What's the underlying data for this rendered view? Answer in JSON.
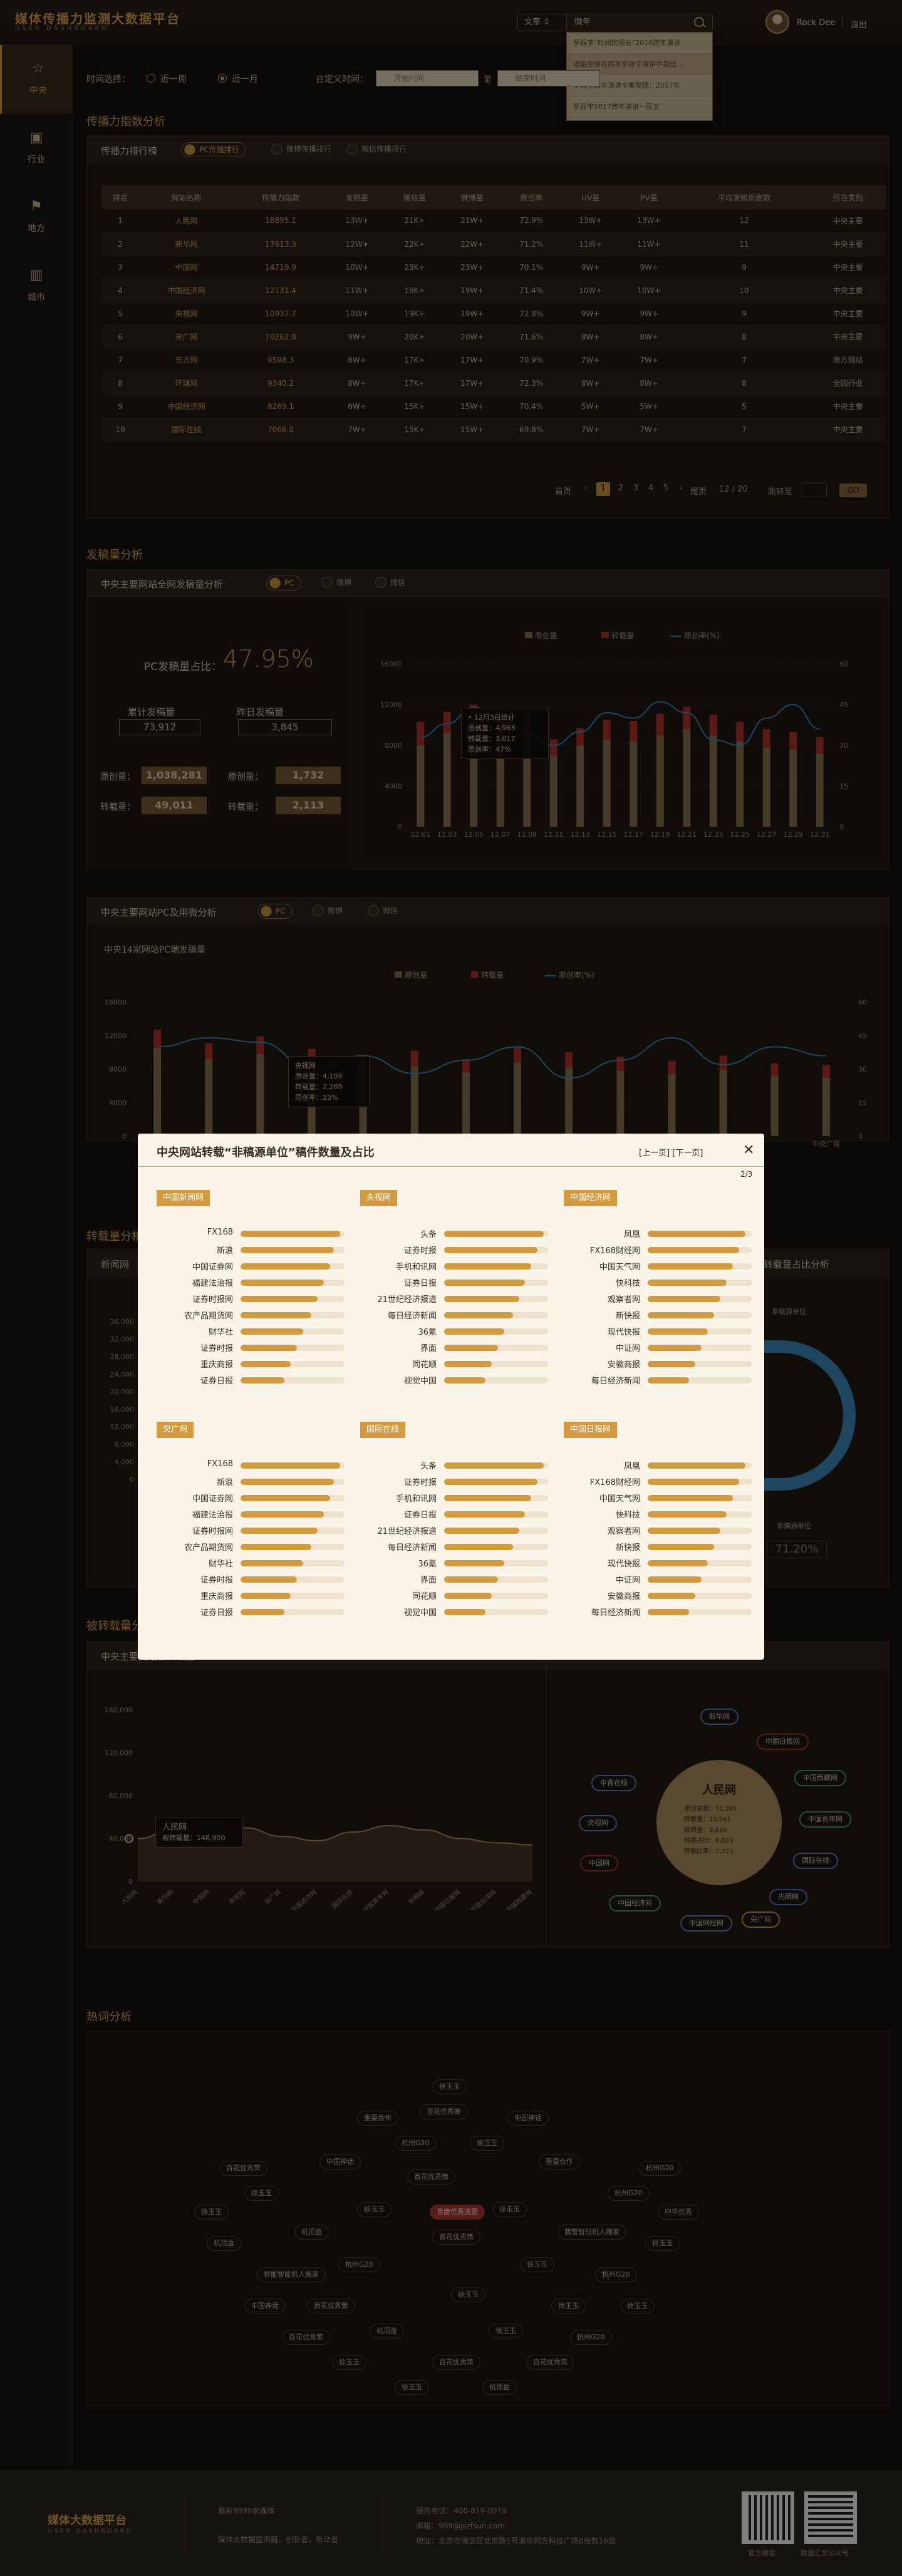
{
  "brand": {
    "title": "媒体传播力监测大数据平台",
    "subtitle": "USER DASHBOARD"
  },
  "search": {
    "type": "文章 ⇕",
    "query": "微年",
    "suggestions": [
      "罗振宇“时间的朋友”2016跨年演讲",
      "逻辑思维在跨年罗振宇演讲中提出…",
      "罗振宇跨年演讲全集整理：2017年",
      "罗振宇2017跨年演讲一原文"
    ]
  },
  "user": {
    "name": "Rock Dee",
    "logout": "退出"
  },
  "sidebar": [
    {
      "label": "中央",
      "icon": "☆"
    },
    {
      "label": "行业",
      "icon": "▣"
    },
    {
      "label": "地方",
      "icon": "⚑"
    },
    {
      "label": "城市",
      "icon": "▥"
    }
  ],
  "filter": {
    "label": "时间选择：",
    "opt1": "近一周",
    "opt2": "近一月",
    "custom": "自定义时间：",
    "start": "开始时间",
    "to": "至",
    "end": "结束时间"
  },
  "sec1": {
    "title": "传播力指数分析",
    "panel": "传播力排行榜",
    "tabs": [
      "PC传播排行",
      "微博传播排行",
      "微信传播排行"
    ]
  },
  "rank_table": {
    "headers": [
      "排名",
      "网站名称",
      "传播力指数",
      "发稿量",
      "微信量",
      "微博量",
      "原创率",
      "UV量",
      "PV量",
      "平均发稿页面数",
      "所在类别"
    ],
    "rows": [
      [
        "1",
        "人民网",
        "18895.1",
        "13W+",
        "21K+",
        "21W+",
        "72.9%",
        "13W+",
        "13W+",
        "12",
        "中央主要"
      ],
      [
        "2",
        "新华网",
        "17613.3",
        "12W+",
        "22K+",
        "22W+",
        "71.2%",
        "11W+",
        "11W+",
        "11",
        "中央主要"
      ],
      [
        "3",
        "中国网",
        "14719.9",
        "10W+",
        "23K+",
        "23W+",
        "70.1%",
        "9W+",
        "9W+",
        "9",
        "中央主要"
      ],
      [
        "4",
        "中国经济网",
        "12131.4",
        "11W+",
        "19K+",
        "19W+",
        "71.4%",
        "10W+",
        "10W+",
        "10",
        "中央主要"
      ],
      [
        "5",
        "央视网",
        "10937.7",
        "10W+",
        "19K+",
        "19W+",
        "72.8%",
        "9W+",
        "9W+",
        "9",
        "中央主要"
      ],
      [
        "6",
        "央广网",
        "10262.8",
        "9W+",
        "20K+",
        "20W+",
        "71.6%",
        "8W+",
        "8W+",
        "8",
        "中央主要"
      ],
      [
        "7",
        "东方网",
        "9598.3",
        "8W+",
        "17K+",
        "17W+",
        "70.9%",
        "7W+",
        "7W+",
        "7",
        "地方网站"
      ],
      [
        "8",
        "环球网",
        "9340.2",
        "8W+",
        "17K+",
        "17W+",
        "72.3%",
        "8W+",
        "8W+",
        "8",
        "全国行业"
      ],
      [
        "9",
        "中国经济网",
        "8269.1",
        "6W+",
        "15K+",
        "15W+",
        "70.4%",
        "5W+",
        "5W+",
        "5",
        "中央主要"
      ],
      [
        "10",
        "国际在线",
        "7066.0",
        "7W+",
        "15K+",
        "15W+",
        "69.8%",
        "7W+",
        "7W+",
        "7",
        "中央主要"
      ]
    ]
  },
  "pager": {
    "prev": "首页",
    "pages": [
      "1",
      "2",
      "3",
      "4",
      "5"
    ],
    "next": "尾页",
    "total": "12 / 20",
    "jump": "跳转至",
    "go": "GO"
  },
  "sec2": {
    "title": "发稿量分析",
    "panel": "中央主要网站全网发稿量分析",
    "tabs": [
      "PC",
      "微博",
      "微信"
    ]
  },
  "pc_share": {
    "label": "PC发稿量占比：",
    "value": "47.95%",
    "total_label": "累计发稿量",
    "total": "73,912",
    "yesterday_label": "昨日发稿量",
    "yesterday": "3,845",
    "orig_label": "原创量：",
    "orig": "1,038,281",
    "orig2_label": "原创量：",
    "orig2": "1,732",
    "repost_label": "转载量：",
    "repost": "49,011",
    "repost2_label": "转载量：",
    "repost2": "2,113"
  },
  "chart1_tip": {
    "title": "• 12月3日统计",
    "l1": "原创量：4,963",
    "l2": "转载量：3,017",
    "l3": "原创率：47%"
  },
  "chart_data": [
    {
      "type": "bar",
      "title": "",
      "categories": [
        "12.01",
        "12.03",
        "12.05",
        "12.07",
        "12.09",
        "12.11",
        "12.13",
        "12.15",
        "12.17",
        "12.19",
        "12.21",
        "12.23",
        "12.25",
        "12.27",
        "12.29",
        "12.31"
      ],
      "series": [
        {
          "name": "原创量",
          "values": [
            8000,
            9200,
            9800,
            9000,
            9400,
            7000,
            8000,
            8600,
            8400,
            9000,
            9600,
            9000,
            8400,
            7800,
            7600,
            7200
          ]
        },
        {
          "name": "转载量",
          "values": [
            2300,
            2100,
            2200,
            1800,
            2000,
            1600,
            1700,
            1900,
            2000,
            2100,
            2200,
            2000,
            1900,
            1800,
            1700,
            1600
          ]
        },
        {
          "name": "原创率(%)",
          "values": [
            33,
            38,
            44,
            40,
            34,
            30,
            35,
            42,
            40,
            46,
            42,
            32,
            30,
            40,
            45,
            36
          ]
        }
      ],
      "ylim": [
        0,
        16000
      ],
      "y2lim": [
        0,
        60
      ],
      "yticks": [
        "0",
        "4000",
        "8000",
        "12000",
        "16000"
      ],
      "y2ticks": [
        "0",
        "15",
        "30",
        "45",
        "60"
      ]
    },
    {
      "type": "bar",
      "title": "中央14家网站PC端发稿量",
      "categories": [
        "",
        "",
        "",
        "",
        "",
        "",
        "",
        "",
        "",
        "",
        "",
        "",
        "",
        "中央广播"
      ],
      "series": [
        {
          "name": "原创量",
          "values": [
            10500,
            9200,
            9800,
            8600,
            8000,
            8400,
            7600,
            8800,
            8200,
            7800,
            7400,
            7900,
            7200,
            7000
          ]
        },
        {
          "name": "转载量",
          "values": [
            2200,
            1900,
            2100,
            1800,
            1700,
            1800,
            1600,
            1900,
            1800,
            1700,
            1600,
            1700,
            1500,
            1500
          ]
        },
        {
          "name": "原创率(%)",
          "values": [
            40,
            44,
            42,
            30,
            36,
            28,
            34,
            40,
            26,
            34,
            44,
            32,
            40,
            36
          ]
        }
      ],
      "ylim": [
        0,
        16000
      ],
      "y2lim": [
        0,
        60
      ],
      "yticks": [
        "0",
        "4000",
        "8000",
        "12000",
        "16000"
      ],
      "y2ticks": [
        "0",
        "15",
        "30",
        "45",
        "60"
      ]
    },
    {
      "type": "area",
      "title": "",
      "x": [
        "人民网",
        "新华网",
        "中国网",
        "央视网",
        "央广网",
        "中国经济网",
        "国际在线",
        "中国青年网",
        "光明网",
        "中国日报网",
        "中国台湾网",
        "中国西藏网"
      ],
      "values": [
        40000,
        48000,
        55000,
        50000,
        42000,
        38000,
        46000,
        52000,
        48000,
        40000,
        36000,
        34000
      ],
      "ylim": [
        0,
        160000
      ],
      "yticks": [
        "0",
        "40,000",
        "80,000",
        "120,000",
        "160,000"
      ]
    }
  ],
  "legend": {
    "orig": "原创量",
    "repost": "转载量",
    "rate": "原创率(%)"
  },
  "sec3": {
    "panel": "中央主要网站PC及用微分析",
    "tabs": [
      "PC",
      "微博",
      "微信"
    ],
    "subtitle": "中央14家网站PC端发稿量"
  },
  "chart2_tip": {
    "title": "央视网",
    "l1": "原创量：4,109",
    "l2": "转载量：2,269",
    "l3": "原创率：23%"
  },
  "sec4": {
    "title": "转载量分析",
    "panel_left": "新闻网",
    "panel_right": "转载量占比分析",
    "donut_label": "非稿源单位",
    "donut_value": "71.20%",
    "legend1": "非稿源单位",
    "yticks": [
      "0",
      "4,000",
      "8,000",
      "12,000",
      "16,000",
      "20,000",
      "24,000",
      "28,000",
      "32,000",
      "36,000"
    ]
  },
  "sec5": {
    "title": "被转载量分析",
    "panel": "中央主要网站被转载量",
    "tip_title": "人民网",
    "tip_val": "被转载量：148,900"
  },
  "network": {
    "center": "人民网",
    "stats": [
      "原创总数：11,281",
      "转载量：10,961",
      "被转量：9,886",
      "转载占比：8,621",
      "转载比率：7,721"
    ],
    "nodes": [
      "新华网",
      "中国日报网",
      "中国西藏网",
      "中国青年网",
      "国际在线",
      "光明网",
      "央广网",
      "中国网经网",
      "中国经济网",
      "中国网",
      "央视网",
      "中青在线"
    ]
  },
  "modal": {
    "title": "中央网站转载“非稿源单位”稿件数量及占比",
    "nav": "[上一页] [下一页]",
    "close": "✕",
    "page": "2/3",
    "groups": [
      {
        "name": "中国新闻网",
        "items": [
          "FX168",
          "新浪",
          "中国证券网",
          "福建法治报",
          "证券时报网",
          "农产品期货网",
          "财华社",
          "证券时报",
          "重庆商报",
          "证券日报"
        ],
        "vals": [
          96,
          90,
          86,
          80,
          74,
          68,
          60,
          54,
          48,
          42
        ]
      },
      {
        "name": "央视网",
        "items": [
          "头条",
          "证券时报",
          "手机和讯网",
          "证券日报",
          "21世纪经济报道",
          "每日经济新闻",
          "36氪",
          "界面",
          "同花顺",
          "视觉中国"
        ],
        "vals": [
          96,
          90,
          84,
          78,
          72,
          66,
          58,
          52,
          46,
          40
        ]
      },
      {
        "name": "中国经济网",
        "items": [
          "凤凰",
          "FX168财经网",
          "中国天气网",
          "快科技",
          "观察者网",
          "新快报",
          "现代快报",
          "中证网",
          "安徽商报",
          "每日经济新闻"
        ],
        "vals": [
          94,
          88,
          82,
          76,
          70,
          64,
          58,
          52,
          46,
          40
        ]
      },
      {
        "name": "央广网",
        "items": [
          "FX168",
          "新浪",
          "中国证券网",
          "福建法治报",
          "证券时报网",
          "农产品期货网",
          "财华社",
          "证券时报",
          "重庆商报",
          "证券日报"
        ],
        "vals": [
          96,
          90,
          86,
          80,
          74,
          68,
          60,
          54,
          48,
          42
        ]
      },
      {
        "name": "国际在线",
        "items": [
          "头条",
          "证券时报",
          "手机和讯网",
          "证券日报",
          "21世纪经济报道",
          "每日经济新闻",
          "36氪",
          "界面",
          "同花顺",
          "视觉中国"
        ],
        "vals": [
          96,
          90,
          84,
          78,
          72,
          66,
          58,
          52,
          46,
          40
        ]
      },
      {
        "name": "中国日报网",
        "items": [
          "凤凰",
          "FX168财经网",
          "中国天气网",
          "快科技",
          "观察者网",
          "新快报",
          "现代快报",
          "中证网",
          "安徽商报",
          "每日经济新闻"
        ],
        "vals": [
          94,
          88,
          82,
          76,
          70,
          64,
          58,
          52,
          46,
          40
        ]
      }
    ]
  },
  "sec6": {
    "title": "热词分析",
    "words": [
      "百花优秀策",
      "徐玉玉",
      "徐玉玉",
      "机顶盒",
      "我警智能机人搬家",
      "杭州G20",
      "徐玉玉",
      "徐玉玉",
      "杭州G20",
      "百花优秀策",
      "徐玉玉",
      "智能智能机人搬家",
      "杭州G20",
      "机顶盒",
      "徐玉玉",
      "杭州G20",
      "徐玉玉",
      "中国神话",
      "重要合作",
      "百花优秀策",
      "徐玉玉",
      "机顶盒",
      "徐玉玉",
      "徐玉玉",
      "中华优秀",
      "百花优秀策",
      "百花优秀策",
      "杭州G20",
      "重要合作",
      "中国神话",
      "中国神话",
      "徐玉玉",
      "百花优秀策",
      "徐玉玉",
      "百花优秀策",
      "徐玉玉",
      "机顶盒",
      "百花优秀策",
      "杭州G20",
      "徐玉玉"
    ],
    "hot": "百度优秀选票"
  },
  "footer": {
    "brand": "媒体大数据平台",
    "brand_sub": "USER DASHBOARD",
    "about": "最新9999家媒体",
    "desc": "媒体大数据监测器，创新者，新动者",
    "phone": "服务电话：400-819-0919",
    "mail": "邮箱：999@jszfsun.com",
    "addr": "地址：北京市海淀区北京路1号清华同方科技广场B座数16层",
    "qr1": "官方微信",
    "qr2": "数据汇文公众号"
  }
}
